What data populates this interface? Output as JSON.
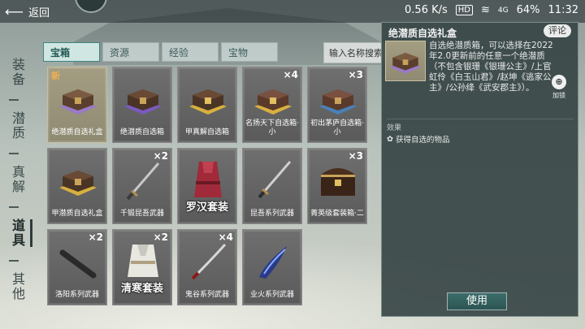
{
  "status_bar": {
    "back_label": "返回",
    "network_speed": "0.56 K/s",
    "hd_badge": "HD",
    "signal_label": "4G",
    "battery": "64%",
    "time": "11:32"
  },
  "side_tabs": [
    {
      "label": "装备",
      "active": false
    },
    {
      "label": "潜质",
      "active": false
    },
    {
      "label": "真解",
      "active": false
    },
    {
      "label": "道具",
      "active": true
    },
    {
      "label": "其他",
      "active": false
    }
  ],
  "filter_tabs": [
    {
      "label": "宝箱",
      "active": true
    },
    {
      "label": "资源",
      "active": false
    },
    {
      "label": "经验",
      "active": false
    },
    {
      "label": "宝物",
      "active": false
    }
  ],
  "search": {
    "placeholder": "输入名称搜索"
  },
  "items": [
    {
      "name": "绝潜质自选礼盒",
      "qty": "",
      "badge": "新",
      "big": false
    },
    {
      "name": "绝潜质自选箱",
      "qty": "",
      "badge": "",
      "big": false
    },
    {
      "name": "甲真解自选箱",
      "qty": "",
      "badge": "",
      "big": false
    },
    {
      "name": "名扬天下自选箱·小",
      "qty": "×4",
      "badge": "",
      "big": false
    },
    {
      "name": "初出茅庐自选箱·小",
      "qty": "×3",
      "badge": "",
      "big": false
    },
    {
      "name": "甲潜质自选礼盒",
      "qty": "",
      "badge": "",
      "big": false
    },
    {
      "name": "千锻昆吾武器",
      "qty": "×2",
      "badge": "",
      "big": false
    },
    {
      "name": "罗汉套装",
      "qty": "",
      "badge": "",
      "big": true
    },
    {
      "name": "昆吾系列武器",
      "qty": "",
      "badge": "",
      "big": false
    },
    {
      "name": "菁英级套装箱·二",
      "qty": "×3",
      "badge": "",
      "big": false
    },
    {
      "name": "洛阳系列武器",
      "qty": "×2",
      "badge": "",
      "big": false
    },
    {
      "name": "清寒套装",
      "qty": "×2",
      "badge": "",
      "big": true
    },
    {
      "name": "鬼谷系列武器",
      "qty": "×4",
      "badge": "",
      "big": false
    },
    {
      "name": "业火系列武器",
      "qty": "",
      "badge": "",
      "big": false
    }
  ],
  "detail": {
    "title": "绝潜质自选礼盒",
    "comment_label": "评论",
    "description": "自选绝潜质箱，可以选择在2022年2.0更新前的任意一个绝潜质（不包含银珊《银珊公主》/上官虹伶《白玉山君》/赵坤《逃家公主》/公孙绛《武安郡主》）。",
    "add_pin_label": "加锁",
    "effect_label": "效果",
    "effect_text": "获得自选的物品",
    "use_label": "使用"
  },
  "colors": {
    "accent_teal": "#3f8680",
    "panel_bg": "#344242",
    "selected_slot": "#a39d82"
  }
}
